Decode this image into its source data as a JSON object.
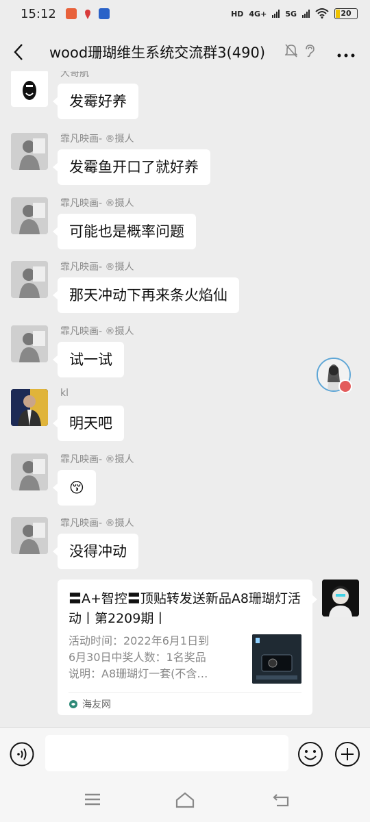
{
  "status_bar": {
    "time": "15:12",
    "network_labels": [
      "HD",
      "4G+",
      "5G"
    ],
    "battery": "20"
  },
  "header": {
    "title": "wood珊瑚维生系统交流群3(490)",
    "icons": [
      "back-icon",
      "mute-bell-icon",
      "ear-icon",
      "more-icon"
    ]
  },
  "messages": [
    {
      "sender": "大哥航",
      "text": "发霉好养"
    },
    {
      "sender": "霏凡映画- ®摄人",
      "text": "发霉鱼开口了就好养"
    },
    {
      "sender": "霏凡映画- ®摄人",
      "text": "可能也是概率问题"
    },
    {
      "sender": "霏凡映画- ®摄人",
      "text": "那天冲动下再来条火焰仙"
    },
    {
      "sender": "霏凡映画- ®摄人",
      "text": "试一试"
    },
    {
      "sender": "kl",
      "text": "明天吧"
    },
    {
      "sender": "霏凡映画- ®摄人",
      "text": "😚"
    },
    {
      "sender": "霏凡映画- ®摄人",
      "text": "没得冲动"
    }
  ],
  "share_card": {
    "title": "〓A+智控〓顶贴转发送新品A8珊瑚灯活动丨第2209期丨",
    "desc_lines": [
      "活动时间：2022年6月1日到",
      "6月30日中奖人数：1名奖品",
      "说明：A8珊瑚灯一套(不含…"
    ],
    "source": "海友网"
  },
  "colors": {
    "background": "#ededed",
    "bubble": "#ffffff",
    "meta_text": "#8a8a8a"
  }
}
